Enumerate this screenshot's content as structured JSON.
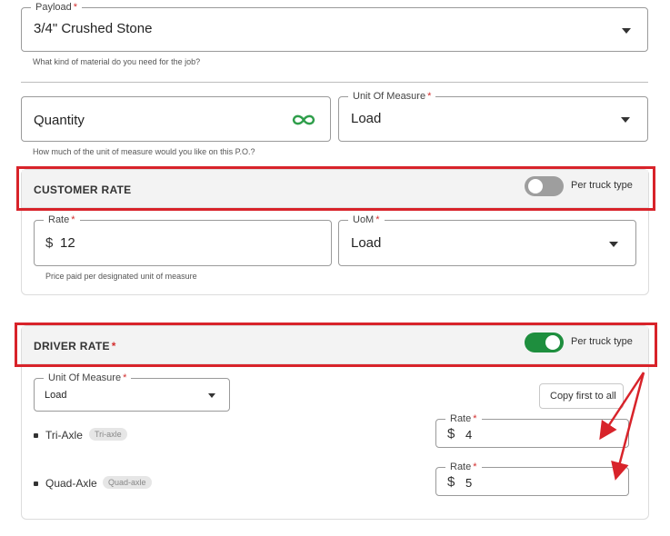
{
  "payload": {
    "label": "Payload",
    "required_mark": "*",
    "value": "3/4\" Crushed Stone",
    "helper": "What kind of material do you need for the job?"
  },
  "quantity": {
    "placeholder": "Quantity",
    "helper": "How much of the unit of measure would you like on this P.O.?",
    "icon": "infinity-icon",
    "icon_color": "#2e9e4a"
  },
  "unit_of_measure": {
    "label": "Unit Of Measure",
    "required_mark": "*",
    "value": "Load"
  },
  "customer_rate": {
    "title": "CUSTOMER RATE",
    "toggle_label": "Per truck type",
    "toggle_on": false,
    "rate": {
      "label": "Rate",
      "required_mark": "*",
      "currency": "$",
      "value": "12"
    },
    "uom": {
      "label": "UoM",
      "required_mark": "*",
      "value": "Load"
    },
    "helper": "Price paid per designated unit of measure"
  },
  "driver_rate": {
    "title": "DRIVER RATE",
    "required_mark": "*",
    "toggle_label": "Per truck type",
    "toggle_on": true,
    "toggle_color": "#1e8e3e",
    "unit_of_measure": {
      "label": "Unit Of Measure",
      "required_mark": "*",
      "value": "Load"
    },
    "copy_button": "Copy first to all",
    "trucks": [
      {
        "name": "Tri-Axle",
        "chip": "Tri-axle",
        "rate_label": "Rate",
        "required_mark": "*",
        "currency": "$",
        "rate": "4"
      },
      {
        "name": "Quad-Axle",
        "chip": "Quad-axle",
        "rate_label": "Rate",
        "required_mark": "*",
        "currency": "$",
        "rate": "5"
      }
    ]
  },
  "annotation_color": "#d8232a"
}
